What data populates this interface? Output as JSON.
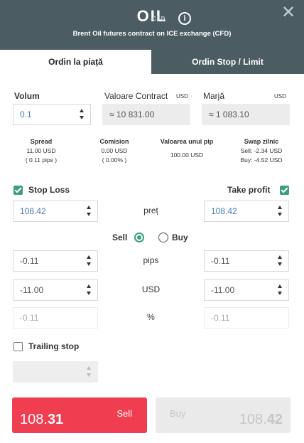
{
  "header": {
    "symbol": "OIL",
    "badge": "CFD",
    "info_icon": "info-icon",
    "subtitle": "Brent Oil futures contract on ICE exchange (CFD)",
    "close_icon": "close-icon"
  },
  "tabs": [
    {
      "label": "Ordin la piață",
      "active": true
    },
    {
      "label": "Ordin Stop / Limit",
      "active": false
    }
  ],
  "volume": {
    "label": "Volum",
    "value": "0.1"
  },
  "contract_value": {
    "label": "Valoare Contract",
    "unit": "USD",
    "value": "≈ 10 831.00"
  },
  "margin": {
    "label": "Marjă",
    "unit": "USD",
    "value": "≈ 1 083.10"
  },
  "stats": {
    "spread": {
      "label": "Spread",
      "line1": "11.00 USD",
      "line2": "( 0.11 pips )"
    },
    "commission": {
      "label": "Comision",
      "line1": "0.00 USD",
      "line2": "( 0.00% )"
    },
    "pip_value": {
      "label": "Valoarea unui pip",
      "line1": "100.00 USD"
    },
    "swap": {
      "label": "Swap zilnic",
      "line1": "Sell: -2.34 USD",
      "line2": "Buy: -4.52 USD"
    }
  },
  "stop_loss": {
    "label": "Stop Loss",
    "checked": true,
    "price": "108.42",
    "pips": "-0.11",
    "usd": "-11.00",
    "percent": "-0.11"
  },
  "take_profit": {
    "label": "Take profit",
    "checked": true,
    "price": "108.42",
    "pips": "-0.11",
    "usd": "-11.00",
    "percent": "-0.11"
  },
  "row_labels": {
    "price": "preț",
    "pips": "pips",
    "usd": "USD",
    "percent": "%"
  },
  "side": {
    "sell_label": "Sell",
    "buy_label": "Buy",
    "selected": "Sell"
  },
  "trailing_stop": {
    "label": "Trailing stop",
    "checked": false,
    "value": ""
  },
  "sell_button": {
    "price_main": "108.",
    "price_big": "31",
    "label": "Sell"
  },
  "buy_button": {
    "price_main": "108.",
    "price_big": "42",
    "label": "Buy"
  },
  "colors": {
    "header_bg": "#4c5c63",
    "accent_green": "#3e9e7d",
    "sell_red": "#f03d4f",
    "input_blue": "#4a7fb5"
  }
}
